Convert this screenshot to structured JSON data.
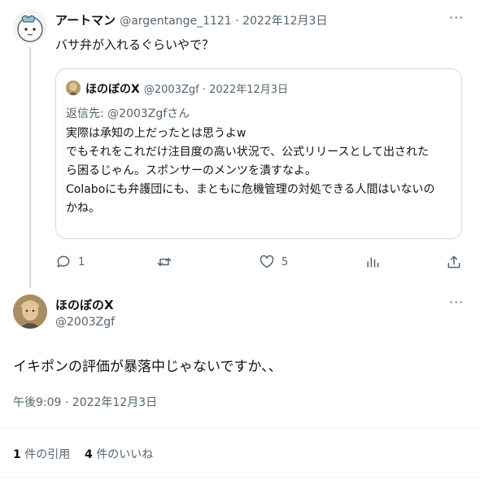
{
  "tweet1": {
    "display_name": "アートマン",
    "handle": "@argentange_1121",
    "date": "2022年12月3日",
    "text": "バサ弁が入れるぐらいやで？"
  },
  "quote": {
    "display_name": "ほのぼのX",
    "handle": "@2003Zgf",
    "date": "2022年12月3日",
    "reply_to": "返信先: @2003Zgfさん",
    "lines": [
      "実際は承知の上だったとは思うよw",
      "でもそれをこれだけ注目度の高い状況で、公式リリースとして出された",
      "ら困るじゃん。スポンサーのメンツを潰すなよ。",
      "Colaboにも弁護団にも、まともに危機管理の対処できる人間はいないの",
      "かね。"
    ]
  },
  "actions": {
    "reply_count": "1",
    "retweet_count": "",
    "like_count": "5"
  },
  "tweet2": {
    "display_name": "ほのぼのX",
    "handle": "@2003Zgf",
    "text": "イキポンの評価が暴落中じゃないですか、、",
    "timestamp": "午後9:09 · 2022年12月3日"
  },
  "stats": {
    "quotes_count": "1",
    "quotes_label": " 件の引用",
    "likes_count": "4",
    "likes_label": " 件のいいね"
  },
  "separator": " · ",
  "more_glyph": "···"
}
